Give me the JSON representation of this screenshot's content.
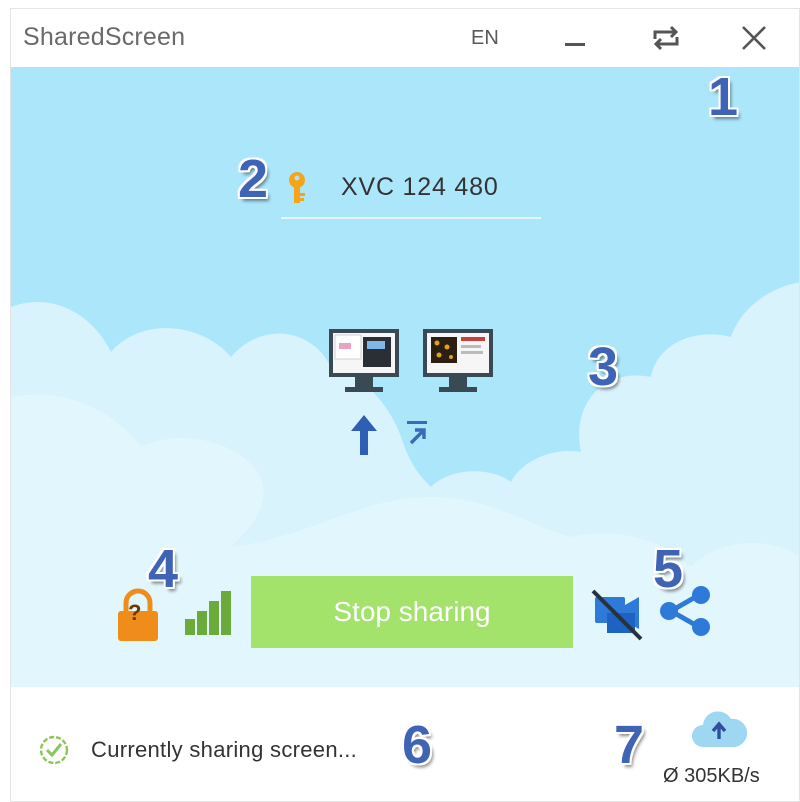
{
  "titlebar": {
    "title": "SharedScreen",
    "language": "EN",
    "minimize_icon": "minimize-icon",
    "restore_icon": "swap-arrows-icon",
    "close_icon": "close-icon"
  },
  "session": {
    "code": "XVC 124 480",
    "key_icon": "key-icon"
  },
  "screens": {
    "monitor_icons": [
      "monitor-local-icon",
      "monitor-remote-icon"
    ],
    "upload_arrow_icon": "arrow-up-icon",
    "expand_icon": "arrow-diagonal-icon"
  },
  "controls": {
    "lock_label": "?",
    "stop_label": "Stop sharing",
    "signal_icon": "signal-bars-icon",
    "camera_off_icon": "camera-off-icon",
    "share_icon": "share-icon"
  },
  "status": {
    "text": "Currently sharing screen...",
    "rate": "Ø 305KB/s",
    "cloud_icon": "cloud-upload-icon"
  },
  "annotations": [
    "1",
    "2",
    "3",
    "4",
    "5",
    "6",
    "7"
  ],
  "colors": {
    "sky": "#ace6fb",
    "cloud": "#d9f3fc",
    "stop_button": "#a3e26b",
    "lock": "#f08c1a",
    "signal": "#6aab3c",
    "accent_blue": "#2e7ad8",
    "annotation": "#3f63b5"
  }
}
